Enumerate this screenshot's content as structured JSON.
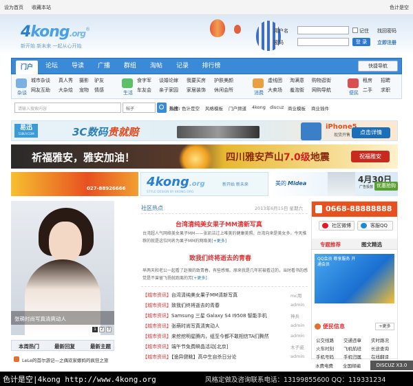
{
  "topbar": {
    "home": "设为首页",
    "fav": "收藏本站",
    "right": "色计是空"
  },
  "logo": {
    "num": "4",
    "word": "kong",
    "org": ".org",
    "reg": "®",
    "slogan": "新开始 新未来 一起从心开始"
  },
  "login": {
    "user_label": "用户名",
    "pass_label": "密码",
    "remember": "记住",
    "find_pass": "找回密码",
    "register": "立即注册",
    "login_btn": "登 录"
  },
  "nav": {
    "items": [
      "门户",
      "论坛",
      "导读",
      "广播",
      "群组",
      "淘帖",
      "记录",
      "排行榜"
    ],
    "quick": "快捷导航"
  },
  "subnav": {
    "groups": [
      {
        "icon": "杂谈",
        "lines": [
          "城市杂谈",
          "真人秀",
          "摄影",
          "驴友",
          "网友互助",
          "大杂烩",
          "宠物",
          "情感"
        ]
      },
      {
        "icon": "生活",
        "lines": [
          "食字军",
          "谈婚论嫁",
          "我要买房",
          "护肤美颜",
          "车友会",
          "亲子家园",
          "家居装饰",
          "休闲会所"
        ]
      },
      {
        "icon": "消费",
        "lines": [
          "虚线团",
          "淘满意",
          "购物逛街",
          "大卖场",
          "羞泡街",
          "网购导航"
        ]
      },
      {
        "icon": "便民",
        "lines": [
          "租房",
          "招聘",
          "二手",
          "求职"
        ]
      }
    ]
  },
  "search": {
    "placeholder": "请输入搜索内容",
    "select": "帖子",
    "hot_label": "热搜:",
    "hot": [
      "色计是空",
      "风格模板",
      "门户频道",
      "4kong",
      "discuz",
      "商业模板",
      "商业插件"
    ]
  },
  "banner1": {
    "logo": "易迅",
    "logo_sub": "51BUY.COM",
    "headline": "3C数码",
    "headline2": "贵就赔",
    "phone": "iPhone5",
    "phone_sub": "现货开售",
    "cta": "点击详情"
  },
  "banner2": {
    "left": "祈福雅安，雅安加油！",
    "center": "四川雅安芦山",
    "magnitude": "7.0级",
    "tail": "地震",
    "cta": "祝福雅安"
  },
  "banner3": {
    "date": "4月30日",
    "date_sub": "广告投放",
    "cta": "优惠抢购",
    "brand": "美的",
    "brand_en": "Midea",
    "ad_tel": "027-88926666",
    "ad_logo": "4kong",
    "ad_org": ".org",
    "ad_tagline": "STYLE DESIGN BY 4KONG.ORG",
    "ad_slogan": "新开始 新未来"
  },
  "photo": {
    "caption": "张萌时尚写真清爽动人",
    "pages": [
      "1",
      "2",
      "3"
    ]
  },
  "ltabs": {
    "items": [
      "本周热门",
      "最新回复",
      "最新主题"
    ],
    "first_item": "LeLe的首尔游记—之偶欢家娜妈的疯狂之旅"
  },
  "mid": {
    "section": "社区热点",
    "date": "2013年6月15日 星期六",
    "h1": "台湾清纯美女果子MM清新写真",
    "d1": "台湾超人气网络美女果子MM——张凯洁过上唯美的健康美照，台湾向来是美女多，今天推荐的就是这位同名为果子MM的网络美",
    "h2": "致我们终将逝去的青春",
    "d2": "早两天和老公一起看了赵薇的致青春，有些感慨。原来我是几年前被看过的，当时看书的感觉是不曾留飞扬就跑离的芳",
    "more": "[+更多]",
    "news": [
      {
        "tag": "【城市资讯】",
        "title": "台湾清纯美女果子MM清新写真",
        "user": "mc用"
      },
      {
        "tag": "【城市资讯】",
        "title": "致我们终将逝去的青春",
        "user": "admin"
      },
      {
        "tag": "【城市资讯】",
        "title": "Samsung 三星 Galaxy S4 I9508 智能手机",
        "user": "神兵"
      },
      {
        "tag": "【城市资讯】",
        "title": "张萌时尚写真清爽动人",
        "user": "admin"
      },
      {
        "tag": "【城市资讯】",
        "title": "来挖挖明星腾内，组至今都不敢相信TA们腾然",
        "user": "admin"
      },
      {
        "tag": "【城市资讯】",
        "title": "端午节免费瞬晶活动[北京]",
        "user": "木子姿"
      },
      {
        "tag": "【城市资讯】",
        "title": "【诡异健眺】高中生自杀日分论",
        "user": "admin"
      }
    ]
  },
  "right": {
    "phone": "0668-88888888",
    "weibo": "社区微博",
    "qq": "客服QQ",
    "tab1": "专题推荐",
    "tab2": "图文精选",
    "promo": "QQ会员 尊享服务 开通会员",
    "service": "便民信息",
    "service_more": "+更多",
    "links": [
      "公交线路",
      "交通违章",
      "实时路况",
      "火车时刻",
      "飞机航班",
      "长途查询",
      "手机号码",
      "手机归属",
      "在线翻译",
      "水费电费",
      "全国邮编",
      "天气预报"
    ]
  },
  "watermark": "DISCUZ X3.0",
  "footer": {
    "left": "色计是空|4kong http://www.4kong.org",
    "right": "风格定做及咨询联系电话：13199855600 QQ：119331234"
  }
}
